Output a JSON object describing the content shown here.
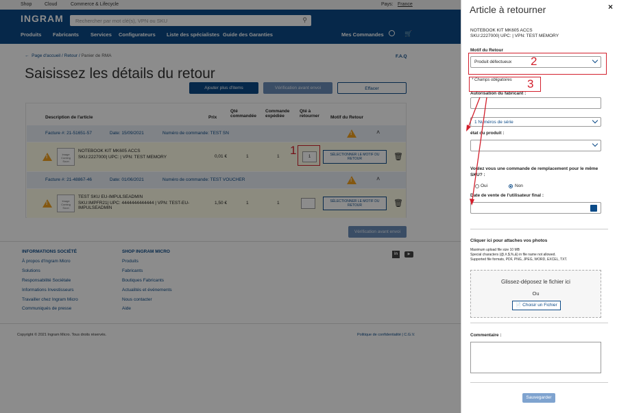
{
  "topbar": {
    "shop": "Shop",
    "cloud": "Cloud",
    "commerce": "Commerce & Lifecycle",
    "pays_label": "Pays:",
    "pays_value": "France"
  },
  "header": {
    "logo": "INGRAM",
    "search_placeholder": "Rechercher par mot clé(s), VPN ou SKU"
  },
  "menu": {
    "produits": "Produits",
    "fabricants": "Fabricants",
    "services": "Services",
    "configurateurs": "Configurateurs",
    "specialistes": "Liste des spécialistes",
    "garanties": "Guide des Garanties",
    "commandes": "Mes Commandes"
  },
  "breadcrumb": {
    "home": "Page d'accueil",
    "retour": "Retour",
    "panier": "Panier de RMA"
  },
  "faq": "F.A.Q",
  "page_title": "Saisissez les détails du retour",
  "actions": {
    "add": "Ajouter plus d'items",
    "verify": "Vérification avant envoi",
    "clear": "Effacer",
    "verify_bottom": "Vérification avant envoi"
  },
  "table": {
    "headers": {
      "desc": "Description de l'article",
      "prix": "Prix",
      "qte_cmd": "Qté commandée",
      "cmd_exp": "Commande expédiée",
      "qte_ret": "Qté à retourner",
      "motif": "Motif du Retour"
    },
    "groups": [
      {
        "facture": "Facture #: 21-51651-57",
        "date": "Date: 15/09/2021",
        "commande": "Numéro de commande: TEST SN"
      },
      {
        "facture": "Facture #: 21-48867-46",
        "date": "Date: 01/06/2021",
        "commande": "Numéro de commande: TEST VOUCHER"
      }
    ],
    "rows": [
      {
        "img": "Image Coming Soon",
        "name": "NOTEBOOK KIT MK605 ACCS",
        "meta": "SKU:2227000| UPC: | VPN: TEST MEMORY",
        "prix": "0,01 €",
        "qte": "1",
        "exp": "1",
        "ret": "1",
        "motif": "SÉLECTIONNER LE MOTIF DU RETOUR"
      },
      {
        "img": "Image Coming Soon",
        "name": "TEST SKU EU-IMPULSEADMIN",
        "meta": "SKU:IMPFR21| UPC: 4444444444444 | VPN: TEST-EU-IMPULSEADMIN",
        "prix": "1,50 €",
        "qte": "1",
        "exp": "1",
        "ret": "",
        "motif": "SÉLECTIONNER LE MOTIF DU RETOUR"
      }
    ]
  },
  "footer": {
    "col1_title": "INFORMATIONS SOCIÉTÉ",
    "col1": [
      "À propos d'Ingram Micro",
      "Solutions",
      "Responsabilité Sociétale",
      "Informations Investisseurs",
      "Travailler chez Ingram Micro",
      "Communiqués de presse"
    ],
    "col2_title": "SHOP INGRAM MICRO",
    "col2": [
      "Produits",
      "Fabricants",
      "Boutiques Fabricants",
      "Actualités et événements",
      "Nous contacter",
      "Aide"
    ],
    "copyright": "Copyright © 2021 Ingram Micro. Tous droits réservés.",
    "legal": "Politique de confidentialité | C.G.V."
  },
  "panel": {
    "title": "Article à retourner",
    "close": "×",
    "product_name": "NOTEBOOK KIT MK605 ACCS",
    "product_meta": "SKU:2227000| UPC: | VPN: TEST MEMORY",
    "motif_label": "Motif du Retour",
    "motif_value": "Produit défectueux",
    "required": "* Champs obligatoires",
    "auth_label": "Autorisation du fabricant :",
    "serial_value": "1 Numéros de série",
    "etat_label": "état du produit :",
    "replace_q": "Voulez vous une commande de remplacement pour le même SKU? :",
    "oui": "Oui",
    "non": "Non",
    "date_label": "Date de vente de l'utilisateur final :",
    "attach_title": "Cliquer ici pour attaches vos photos",
    "attach_info1": "Maximum upload file size 10 MB",
    "attach_info2": "Special characters (@,#,$,%,&) in file name not allowed.",
    "attach_info3": "Supported file formats, PDF, PNG, JPEG, WORD, EXCEL, TXT.",
    "drop_text": "Glissez-déposez le fichier ici",
    "drop_or": "Ou",
    "choose": "Choisir un Fichier",
    "comment_label": "Commentaire :",
    "save": "Sauvegarder"
  },
  "annotations": {
    "n1": "1",
    "n2": "2",
    "n3": "3"
  },
  "colors": {
    "navy": "#0b4a87",
    "annotation": "#d21e2b",
    "warning": "#f0a020"
  }
}
